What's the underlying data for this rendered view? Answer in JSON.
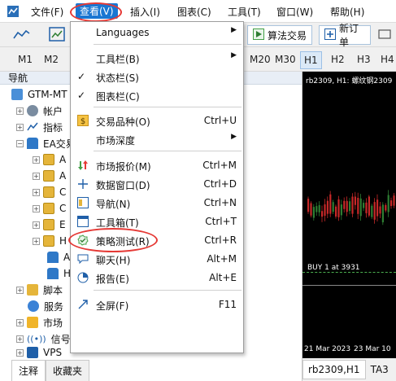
{
  "menubar": {
    "items": [
      "文件(F)",
      "查看(V)",
      "插入(I)",
      "图表(C)",
      "工具(T)",
      "窗口(W)",
      "帮助(H)"
    ]
  },
  "toolbar": {
    "algo_label": "算法交易",
    "neworder_label": "新订单"
  },
  "timeframes": [
    "M1",
    "M2",
    "M20",
    "M30",
    "H1",
    "H2",
    "H3",
    "H4"
  ],
  "navigator": {
    "title": "导航",
    "rows": [
      {
        "label": "GTM-MT",
        "icon": "broker-icon"
      },
      {
        "label": "帐户",
        "icon": "accounts-icon"
      },
      {
        "label": "指标",
        "icon": "indicators-icon"
      },
      {
        "label": "EA交易",
        "icon": "ea-icon"
      },
      {
        "label": "A",
        "icon": "folder-icon"
      },
      {
        "label": "A",
        "icon": "folder-icon"
      },
      {
        "label": "C",
        "icon": "folder-icon"
      },
      {
        "label": "C",
        "icon": "folder-icon"
      },
      {
        "label": "E",
        "icon": "folder-icon"
      },
      {
        "label": "H",
        "icon": "folder-icon"
      },
      {
        "label": "A",
        "icon": "ea-file-icon"
      },
      {
        "label": "H",
        "icon": "ea-file-icon"
      },
      {
        "label": "脚本",
        "icon": "scripts-icon"
      },
      {
        "label": "服务",
        "icon": "services-icon"
      },
      {
        "label": "市场",
        "icon": "market-icon"
      },
      {
        "label": "信号",
        "icon": "signals-icon"
      },
      {
        "label": "VPS",
        "icon": "vps-icon"
      }
    ],
    "tabs": [
      "注释",
      "收藏夹"
    ]
  },
  "view_menu": {
    "items": [
      {
        "label": "Languages",
        "shortcut": "",
        "submenu": true,
        "icon": ""
      },
      {
        "label": "工具栏(B)",
        "shortcut": "",
        "submenu": true,
        "icon": ""
      },
      {
        "label": "状态栏(S)",
        "shortcut": "",
        "submenu": false,
        "icon": "check-icon",
        "checked": true
      },
      {
        "label": "图表栏(C)",
        "shortcut": "",
        "submenu": false,
        "icon": "check-icon",
        "checked": true
      },
      {
        "label": "交易品种(O)",
        "shortcut": "Ctrl+U",
        "submenu": false,
        "icon": "dollar-icon"
      },
      {
        "label": "市场深度",
        "shortcut": "",
        "submenu": true,
        "icon": ""
      },
      {
        "label": "市场报价(M)",
        "shortcut": "Ctrl+M",
        "submenu": false,
        "icon": "market-watch-icon"
      },
      {
        "label": "数据窗口(D)",
        "shortcut": "Ctrl+D",
        "submenu": false,
        "icon": "crosshair-icon"
      },
      {
        "label": "导航(N)",
        "shortcut": "Ctrl+N",
        "submenu": false,
        "icon": "navigator-icon"
      },
      {
        "label": "工具箱(T)",
        "shortcut": "Ctrl+T",
        "submenu": false,
        "icon": "toolbox-icon"
      },
      {
        "label": "策略测试(R)",
        "shortcut": "Ctrl+R",
        "submenu": false,
        "icon": "strategy-tester-icon"
      },
      {
        "label": "聊天(H)",
        "shortcut": "Alt+M",
        "submenu": false,
        "icon": "chat-icon"
      },
      {
        "label": "报告(E)",
        "shortcut": "Alt+E",
        "submenu": false,
        "icon": "report-icon"
      },
      {
        "label": "全屏(F)",
        "shortcut": "F11",
        "submenu": false,
        "icon": "fullscreen-icon"
      }
    ]
  },
  "chart": {
    "title": "rb2309, H1:  螺纹钢2309",
    "order_label": "BUY 1 at 3931",
    "date1": "21 Mar 2023",
    "date2": "23 Mar 10",
    "tabs": [
      "rb2309,H1",
      "TA3"
    ]
  },
  "colors": {
    "accent": "#1976d2",
    "highlight_oval": "#e53935",
    "bull_candle": "#2e7d32",
    "bear_candle": "#c62828"
  }
}
